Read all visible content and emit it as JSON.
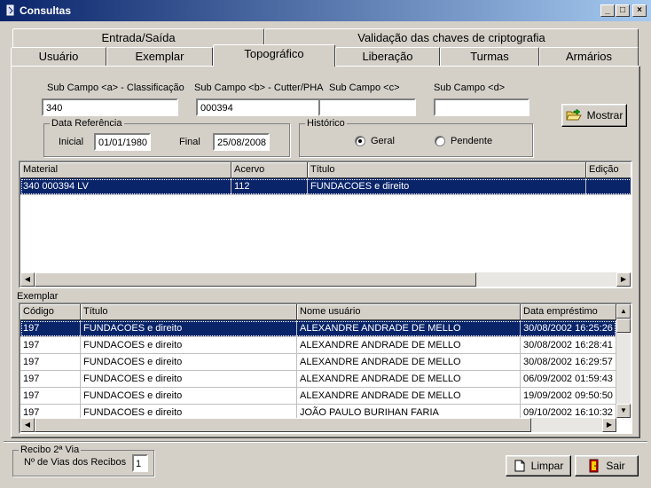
{
  "window": {
    "title": "Consultas",
    "controls": {
      "minimize": "_",
      "maximize": "□",
      "close": "×"
    }
  },
  "tabs_row1": [
    {
      "label": "Entrada/Saída"
    },
    {
      "label": "Validação das chaves de criptografia"
    }
  ],
  "tabs_row2": [
    {
      "label": "Usuário"
    },
    {
      "label": "Exemplar"
    },
    {
      "label": "Topográfico",
      "active": true
    },
    {
      "label": "Liberação"
    },
    {
      "label": "Turmas"
    },
    {
      "label": "Armários"
    }
  ],
  "filters": {
    "subcampo_a": {
      "label": "Sub Campo <a> - Classificação",
      "value": "340"
    },
    "subcampo_b": {
      "label": "Sub Campo <b> - Cutter/PHA",
      "value": "000394"
    },
    "subcampo_c": {
      "label": "Sub Campo <c>",
      "value": ""
    },
    "subcampo_d": {
      "label": "Sub Campo <d>",
      "value": ""
    }
  },
  "data_referencia": {
    "legend": "Data Referência",
    "inicial_label": "Inicial",
    "inicial_value": "01/01/1980",
    "final_label": "Final",
    "final_value": "25/08/2008"
  },
  "historico": {
    "legend": "Histórico",
    "options": [
      {
        "label": "Geral",
        "checked": true
      },
      {
        "label": "Pendente",
        "checked": false
      }
    ]
  },
  "mostrar_button": {
    "label": "Mostrar",
    "icon": "folder-open-icon"
  },
  "material_grid": {
    "columns": [
      "Material",
      "Acervo",
      "Título",
      "Edição"
    ],
    "rows": [
      {
        "material": "340  000394  LV",
        "acervo": "112",
        "titulo": "FUNDACOES e direito",
        "edicao": ""
      }
    ]
  },
  "exemplar_section": {
    "label": "Exemplar",
    "columns": [
      "Código",
      "Título",
      "Nome usuário",
      "Data empréstimo"
    ],
    "rows": [
      {
        "codigo": "197",
        "titulo": "FUNDACOES e direito",
        "nome": "ALEXANDRE ANDRADE DE MELLO",
        "data": "30/08/2002 16:25:26"
      },
      {
        "codigo": "197",
        "titulo": "FUNDACOES e direito",
        "nome": "ALEXANDRE ANDRADE DE MELLO",
        "data": "30/08/2002 16:28:41"
      },
      {
        "codigo": "197",
        "titulo": "FUNDACOES e direito",
        "nome": "ALEXANDRE ANDRADE DE MELLO",
        "data": "30/08/2002 16:29:57"
      },
      {
        "codigo": "197",
        "titulo": "FUNDACOES e direito",
        "nome": "ALEXANDRE ANDRADE DE MELLO",
        "data": "06/09/2002 01:59:43"
      },
      {
        "codigo": "197",
        "titulo": "FUNDACOES e direito",
        "nome": "ALEXANDRE ANDRADE DE MELLO",
        "data": "19/09/2002 09:50:50"
      },
      {
        "codigo": "197",
        "titulo": "FUNDACOES e direito",
        "nome": "JOÃO PAULO BURIHAN FARIA",
        "data": "09/10/2002 16:10:32"
      }
    ]
  },
  "recibo": {
    "legend": "Recibo 2ª Via",
    "label": "Nº de Vias dos Recibos",
    "value": "1"
  },
  "footer_buttons": {
    "limpar": "Limpar",
    "sair": "Sair"
  }
}
